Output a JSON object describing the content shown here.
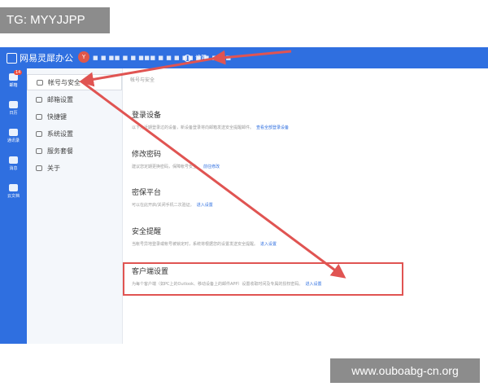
{
  "watermark": {
    "tag": "TG: MYYJJPP",
    "url": "www.ouboabg-cn.org"
  },
  "topbar": {
    "app_title": "网易灵犀办公",
    "avatar_letter": "Y",
    "account_masked": "■ ■ ■■ ■ ■ ■■■ ■ ■ ■ ■■ ■ ■ ■ ■■",
    "settings_label": "设置"
  },
  "rail": {
    "items": [
      {
        "label": "邮箱",
        "badge": "14",
        "icon": "mail-icon"
      },
      {
        "label": "日历",
        "icon": "calendar-icon"
      },
      {
        "label": "通讯录",
        "icon": "contacts-icon"
      },
      {
        "label": "消息",
        "icon": "chat-icon"
      },
      {
        "label": "云文档",
        "icon": "folder-icon"
      }
    ]
  },
  "menu": {
    "items": [
      {
        "label": "帐号与安全",
        "icon": "user-icon",
        "active": true
      },
      {
        "label": "邮箱设置",
        "icon": "mail-icon"
      },
      {
        "label": "快捷键",
        "icon": "keyboard-icon"
      },
      {
        "label": "系统设置",
        "icon": "gear-icon"
      },
      {
        "label": "服务套餐",
        "icon": "package-icon"
      },
      {
        "label": "关于",
        "icon": "info-icon"
      }
    ]
  },
  "main": {
    "breadcrumb": "帐号与安全",
    "sections": [
      {
        "title": "登录设备",
        "desc": "以下为近期登录过的设备，新设备登录将向邮箱发送安全提醒邮件。",
        "link": "查看全部登录设备"
      },
      {
        "title": "修改密码",
        "desc": "建议您定期更换密码，保障帐号安全。",
        "link": "前往修改"
      },
      {
        "title": "密保平台",
        "desc": "可以在此开启/关闭手机二次验证。",
        "link": "进入设置"
      },
      {
        "title": "安全提醒",
        "desc": "当帐号异地登录或帐号被锁定时，系统将根据您的设置发送安全提醒。",
        "link": "进入设置"
      },
      {
        "title": "客户端设置",
        "desc": "为每个客户端（如PC上的Outlook、移动设备上的邮件APP）设置收取时间及专属的授权密码。",
        "link": "进入设置"
      }
    ]
  },
  "colors": {
    "primary": "#2f6fe0",
    "annotation": "#e05452",
    "watermark_bg": "#8c8c8c"
  }
}
